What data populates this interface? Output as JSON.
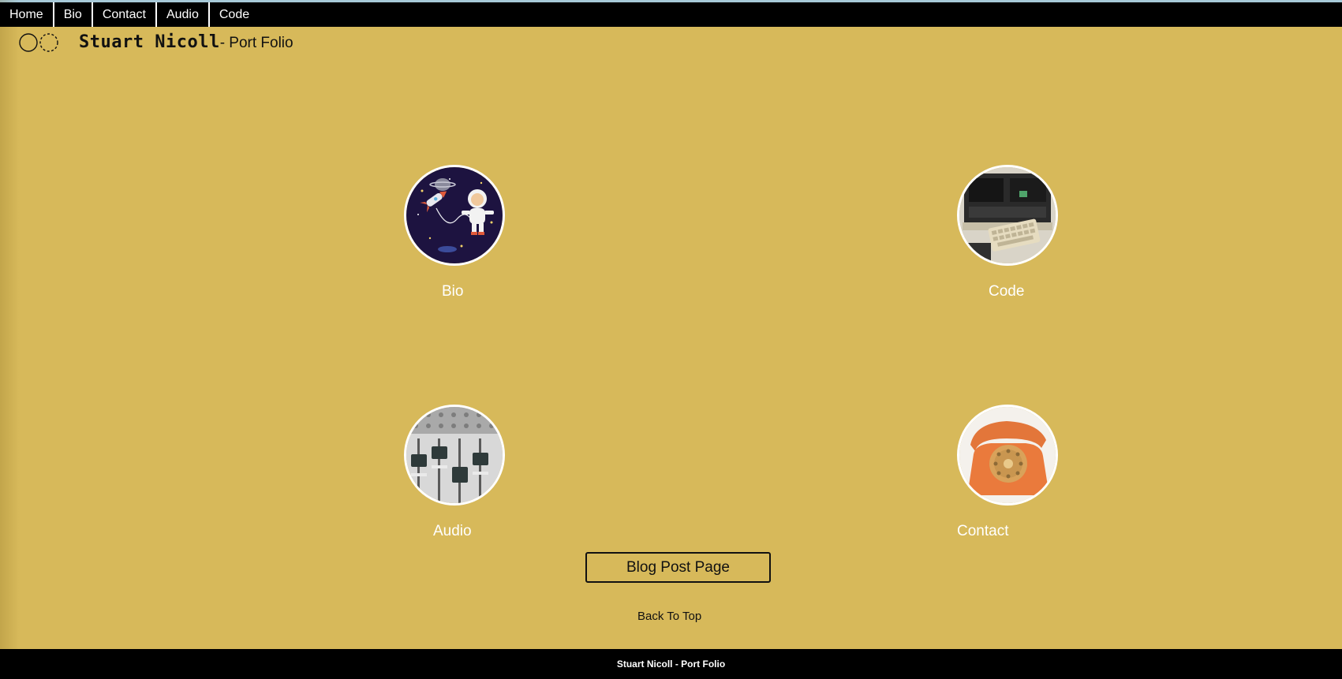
{
  "nav": {
    "items": [
      {
        "label": "Home"
      },
      {
        "label": "Bio"
      },
      {
        "label": "Contact"
      },
      {
        "label": "Audio"
      },
      {
        "label": "Code"
      }
    ]
  },
  "header": {
    "logo_icon": "double-circle-logo-icon",
    "name": "Stuart Nicoll",
    "subtitle": "- Port Folio"
  },
  "tiles": [
    {
      "label": "Bio",
      "image": "astronaut-space-illustration"
    },
    {
      "label": "Code",
      "image": "vintage-computer-photo"
    },
    {
      "label": "Audio",
      "image": "mixing-desk-faders-photo"
    },
    {
      "label": "Contact",
      "image": "orange-rotary-telephone-photo"
    }
  ],
  "blog_button": {
    "label": "Blog Post Page"
  },
  "back_to_top": {
    "label": "Back To Top"
  },
  "footer": {
    "text": "Stuart Nicoll - Port Folio"
  },
  "colors": {
    "background": "#d7b95a",
    "nav_background": "#000000",
    "tile_label": "#ffffff"
  }
}
